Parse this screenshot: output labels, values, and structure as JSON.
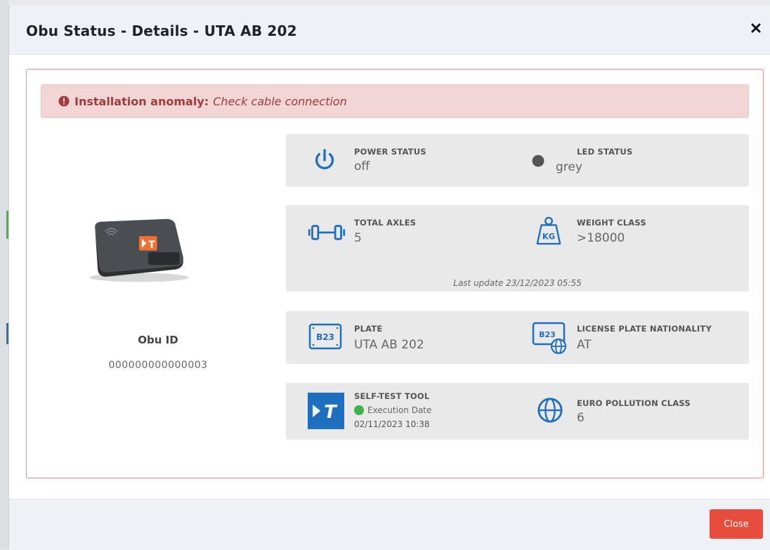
{
  "modal": {
    "title": "Obu Status - Details - UTA AB 202",
    "close_icon": "close-icon"
  },
  "alert": {
    "icon": "exclamation-circle-icon",
    "title": "Installation anomaly:",
    "message": "Check cable connection",
    "color": "#a33b3b"
  },
  "device": {
    "image": "obu-device-image",
    "logo_text": "T",
    "id_label": "Obu ID",
    "id_value": "000000000000003"
  },
  "cards": {
    "power": {
      "power_label": "POWER STATUS",
      "power_value": "off",
      "power_icon": "power-icon",
      "led_label": "LED STATUS",
      "led_value": "grey",
      "led_icon": "led-dot-icon"
    },
    "vehicle": {
      "axles_label": "TOTAL AXLES",
      "axles_value": "5",
      "axles_icon": "axle-icon",
      "weight_label": "WEIGHT CLASS",
      "weight_value": ">18000",
      "weight_icon": "weight-kg-icon",
      "weight_icon_text": "KG",
      "last_update": "Last update 23/12/2023 05:55"
    },
    "plate": {
      "plate_label": "PLATE",
      "plate_value": "UTA AB 202",
      "plate_icon": "license-plate-icon",
      "plate_icon_text": "B23",
      "nationality_label": "LICENSE PLATE NATIONALITY",
      "nationality_value": "AT",
      "nationality_icon": "plate-globe-icon",
      "nationality_icon_text": "B23"
    },
    "selftest": {
      "tool_label": "SELF-TEST TOOL",
      "tool_icon": "self-test-tool-logo-icon",
      "tool_logo_text": "T",
      "exec_label": "Execution Date",
      "exec_date": "02/11/2023 10:38",
      "exec_status_icon": "green-status-dot-icon",
      "euro_label": "EURO POLLUTION CLASS",
      "euro_value": "6",
      "euro_icon": "globe-icon"
    }
  },
  "footer": {
    "close_label": "Close"
  },
  "colors": {
    "accent_blue": "#1f6fc1",
    "close_button": "#e84c3d",
    "alert_bg": "#f2d6d6",
    "card_bg": "#e9e9e9",
    "led_grey": "#555555",
    "status_green": "#3cb44b",
    "orange": "#f07030"
  }
}
